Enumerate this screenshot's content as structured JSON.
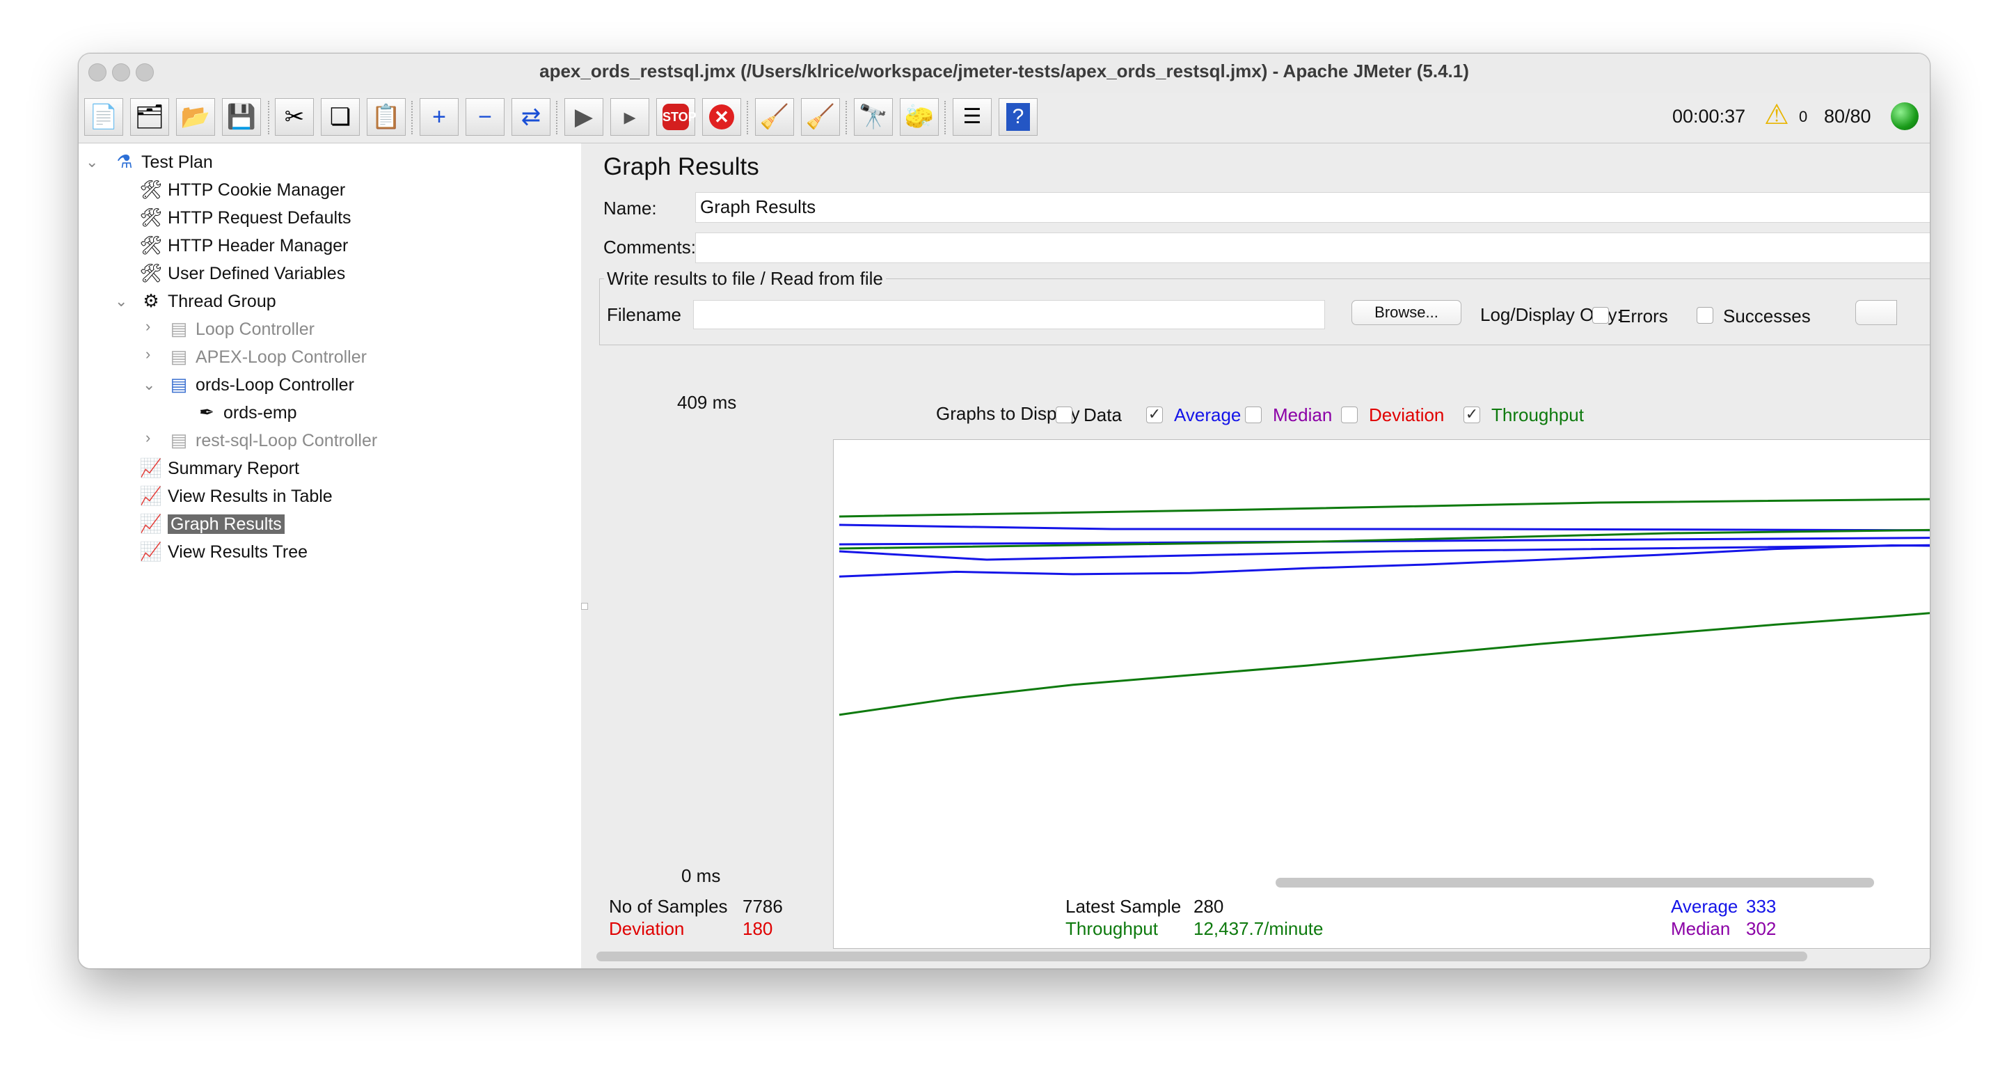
{
  "window": {
    "title": "apex_ords_restsql.jmx (/Users/klrice/workspace/jmeter-tests/apex_ords_restsql.jmx) - Apache JMeter (5.4.1)"
  },
  "toolbar": {
    "buttons": [
      "new-icon",
      "templates-icon",
      "open-icon",
      "save-icon",
      "cut-icon",
      "copy-icon",
      "paste-icon",
      "expand-icon",
      "collapse-icon",
      "toggle-icon",
      "start-icon",
      "start-no-pauses-icon",
      "stop-icon",
      "shutdown-icon",
      "clear-icon",
      "clear-all-icon",
      "search-icon",
      "reset-search-icon",
      "function-helper-icon",
      "help-icon"
    ],
    "elapsed": "00:00:37",
    "warnings": "0",
    "threads": "80/80"
  },
  "tree": {
    "items": [
      {
        "label": "Test Plan",
        "icon": "flask-icon"
      },
      {
        "label": "HTTP Cookie Manager",
        "icon": "wrench-icon"
      },
      {
        "label": "HTTP Request Defaults",
        "icon": "wrench-icon"
      },
      {
        "label": "HTTP Header Manager",
        "icon": "wrench-icon"
      },
      {
        "label": "User Defined Variables",
        "icon": "wrench-icon"
      },
      {
        "label": "Thread Group",
        "icon": "gear-icon"
      },
      {
        "label": "Loop Controller",
        "icon": "controller-icon"
      },
      {
        "label": "APEX-Loop Controller",
        "icon": "controller-icon"
      },
      {
        "label": "ords-Loop Controller",
        "icon": "controller-icon"
      },
      {
        "label": "ords-emp",
        "icon": "pipette-icon"
      },
      {
        "label": "rest-sql-Loop Controller",
        "icon": "controller-icon"
      },
      {
        "label": "Summary Report",
        "icon": "chart-icon"
      },
      {
        "label": "View Results in Table",
        "icon": "chart-icon"
      },
      {
        "label": "Graph Results",
        "icon": "chart-icon"
      },
      {
        "label": "View Results Tree",
        "icon": "chart-icon"
      }
    ]
  },
  "panel": {
    "title": "Graph Results",
    "name_label": "Name:",
    "name_value": "Graph Results",
    "comments_label": "Comments:",
    "comments_value": "",
    "file_group_title": "Write results to file / Read from file",
    "filename_label": "Filename",
    "filename_value": "",
    "browse_label": "Browse...",
    "log_display_label": "Log/Display Only:",
    "errors_label": "Errors",
    "successes_label": "Successes",
    "graphs_label": "Graphs to Display",
    "opt_data": "Data",
    "opt_average": "Average",
    "opt_median": "Median",
    "opt_deviation": "Deviation",
    "opt_throughput": "Throughput",
    "checked_average": true,
    "checked_throughput": true,
    "y_max_label": "409  ms",
    "y_min_label": "0  ms"
  },
  "stats": {
    "samples_label": "No of Samples",
    "samples_value": "7786",
    "latest_label": "Latest Sample",
    "latest_value": "280",
    "average_label": "Average",
    "average_value": "333",
    "deviation_label": "Deviation",
    "deviation_value": "180",
    "throughput_label": "Throughput",
    "throughput_value": "12,437.7/minute",
    "median_label": "Median",
    "median_value": "302"
  },
  "colors": {
    "average": "#1515e8",
    "median": "#8b00a6",
    "deviation": "#e00000",
    "throughput": "#0e7a0e",
    "data": "#000000"
  },
  "chart_data": {
    "type": "line",
    "ylim": [
      0,
      409
    ],
    "series": [
      {
        "name": "Average",
        "values": [
          308,
          312,
          310,
          311,
          315,
          318,
          322,
          326,
          331,
          334,
          333
        ]
      },
      {
        "name": "Throughput",
        "values": [
          193,
          207,
          218,
          226,
          234,
          243,
          252,
          260,
          268,
          275,
          283
        ]
      }
    ]
  }
}
